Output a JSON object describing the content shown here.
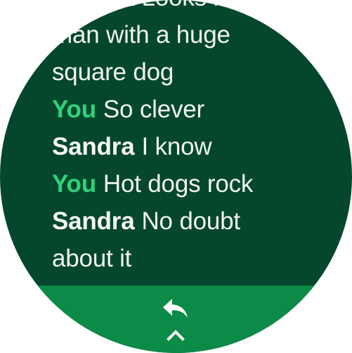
{
  "conversation": {
    "messages": [
      {
        "sender": "Sandra",
        "is_you": false,
        "text": "Looks like a man with a huge square dog"
      },
      {
        "sender": "You",
        "is_you": true,
        "text": "So clever"
      },
      {
        "sender": "Sandra",
        "is_you": false,
        "text": "I know"
      },
      {
        "sender": "You",
        "is_you": true,
        "text": "Hot dogs rock"
      },
      {
        "sender": "Sandra",
        "is_you": false,
        "text": "No doubt about it"
      }
    ]
  },
  "actions": {
    "reply_icon": "reply-icon",
    "expand_icon": "chevron-up-icon"
  },
  "colors": {
    "background": "#05472c",
    "reply_bar": "#0c8a47",
    "you_name": "#2ed27a",
    "text": "#f1f4f1"
  }
}
